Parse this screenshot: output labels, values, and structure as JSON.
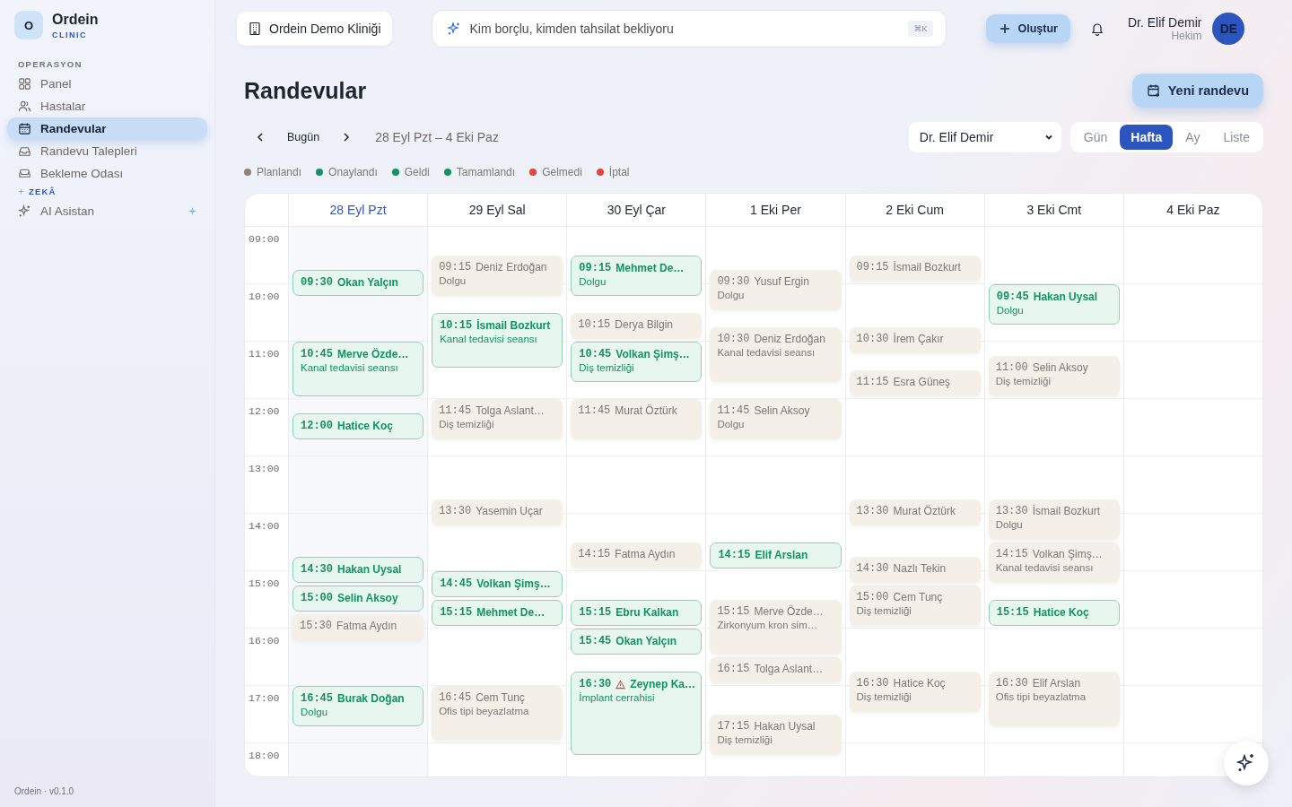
{
  "brand": {
    "logo_letter": "O",
    "name": "Ordein",
    "subtitle": "CLINIC"
  },
  "sidebar": {
    "sections": [
      {
        "title": "OPERASYON",
        "sparkle": false,
        "items": [
          {
            "label": "Panel",
            "selected": false,
            "sparkle": false
          },
          {
            "label": "Hastalar",
            "selected": false,
            "sparkle": false
          },
          {
            "label": "Randevular",
            "selected": true,
            "sparkle": false
          },
          {
            "label": "Randevu Talepleri",
            "selected": false,
            "sparkle": false
          },
          {
            "label": "Bekleme Odası",
            "selected": false,
            "sparkle": false
          }
        ]
      },
      {
        "title": "ZEKÂ",
        "sparkle": true,
        "items": [
          {
            "label": "AI Asistan",
            "selected": false,
            "sparkle": true
          }
        ]
      }
    ],
    "footer": "Ordein · v0.1.0"
  },
  "topbar": {
    "clinic": "Ordein Demo Kliniği",
    "search_value": "Kim borçlu, kimden tahsilat bekliyoru",
    "shortcut": "⌘K",
    "create_button": "Oluştur",
    "user_name": "Dr. Elif Demir",
    "user_role": "Hekim",
    "avatar": "DE"
  },
  "page": {
    "title": "Randevular",
    "new_button": "Yeni randevu",
    "today_button": "Bugün",
    "range": "28 Eyl Pzt – 4 Eki Paz",
    "doctor": "Dr. Elif Demir",
    "views": [
      {
        "label": "Gün",
        "selected": false
      },
      {
        "label": "Hafta",
        "selected": true
      },
      {
        "label": "Ay",
        "selected": false
      },
      {
        "label": "Liste",
        "selected": false
      }
    ]
  },
  "legend": [
    {
      "label": "Planlandı",
      "color": "#8a8378"
    },
    {
      "label": "Onaylandı",
      "color": "#14935f"
    },
    {
      "label": "Geldi",
      "color": "#14935f"
    },
    {
      "label": "Tamamlandı",
      "color": "#14935f"
    },
    {
      "label": "Gelmedi",
      "color": "#e5443a"
    },
    {
      "label": "İptal",
      "color": "#e5443a"
    }
  ],
  "calendar": {
    "hours": [
      "09:00",
      "10:00",
      "11:00",
      "12:00",
      "13:00",
      "14:00",
      "15:00",
      "16:00",
      "17:00",
      "18:00"
    ],
    "days": [
      {
        "label": "28 Eyl Pzt",
        "selected": true,
        "events": [
          {
            "time": "09:30",
            "name": "Okan Yalçın",
            "kind": "short",
            "confirmed": true,
            "warning": false
          },
          {
            "time": "10:45",
            "name": "Merve Özde…",
            "service": "Kanal tedavisi seansı",
            "kind": "long",
            "confirmed": true,
            "warning": false
          },
          {
            "time": "12:00",
            "name": "Hatice Koç",
            "kind": "short",
            "confirmed": true,
            "warning": false
          },
          {
            "time": "14:30",
            "name": "Hakan Uysal",
            "kind": "short",
            "confirmed": true,
            "warning": false
          },
          {
            "time": "15:00",
            "name": "Selin Aksoy",
            "kind": "short",
            "confirmed": true,
            "warning": false
          },
          {
            "time": "15:30",
            "name": "Fatma Aydın",
            "kind": "short",
            "confirmed": false,
            "warning": false
          },
          {
            "time": "16:45",
            "name": "Burak Doğan",
            "service": "Dolgu",
            "kind": "medium",
            "confirmed": true,
            "warning": false
          }
        ]
      },
      {
        "label": "29 Eyl Sal",
        "selected": false,
        "events": [
          {
            "time": "09:15",
            "name": "Deniz Erdoğan",
            "service": "Dolgu",
            "kind": "medium",
            "confirmed": false,
            "warning": false
          },
          {
            "time": "10:15",
            "name": "İsmail Bozkurt",
            "service": "Kanal tedavisi seansı",
            "kind": "long",
            "confirmed": true,
            "warning": false
          },
          {
            "time": "11:45",
            "name": "Tolga Aslant…",
            "service": "Diş temizliği",
            "kind": "medium",
            "confirmed": false,
            "warning": false
          },
          {
            "time": "13:30",
            "name": "Yasemin Uçar",
            "kind": "short",
            "confirmed": false,
            "warning": false
          },
          {
            "time": "14:45",
            "name": "Volkan Şimş…",
            "kind": "short",
            "confirmed": true,
            "warning": false
          },
          {
            "time": "15:15",
            "name": "Mehmet De…",
            "kind": "short",
            "confirmed": true,
            "warning": false
          },
          {
            "time": "16:45",
            "name": "Cem Tunç",
            "service": "Ofis tipi beyazlatma",
            "kind": "long",
            "confirmed": false,
            "warning": false
          }
        ]
      },
      {
        "label": "30 Eyl Çar",
        "selected": false,
        "events": [
          {
            "time": "09:15",
            "name": "Mehmet De…",
            "service": "Dolgu",
            "kind": "medium",
            "confirmed": true,
            "warning": false
          },
          {
            "time": "10:15",
            "name": "Derya Bilgin",
            "kind": "short",
            "confirmed": false,
            "warning": false
          },
          {
            "time": "10:45",
            "name": "Volkan Şimş…",
            "service": "Diş temizliği",
            "kind": "medium",
            "confirmed": true,
            "warning": false
          },
          {
            "time": "11:45",
            "name": "Murat Öztürk",
            "kind": "medium",
            "confirmed": false,
            "warning": false
          },
          {
            "time": "14:15",
            "name": "Fatma Aydın",
            "kind": "short",
            "confirmed": false,
            "warning": false
          },
          {
            "time": "15:15",
            "name": "Ebru Kalkan",
            "kind": "short",
            "confirmed": true,
            "warning": false
          },
          {
            "time": "15:45",
            "name": "Okan Yalçın",
            "kind": "short",
            "confirmed": true,
            "warning": false
          },
          {
            "time": "16:30",
            "name": "Zeynep Ka…",
            "service": "İmplant cerrahisi",
            "kind": "xlong",
            "confirmed": true,
            "warning": true
          }
        ]
      },
      {
        "label": "1 Eki Per",
        "selected": false,
        "events": [
          {
            "time": "09:30",
            "name": "Yusuf Ergin",
            "service": "Dolgu",
            "kind": "medium",
            "confirmed": false,
            "warning": false
          },
          {
            "time": "10:30",
            "name": "Deniz Erdoğan",
            "service": "Kanal tedavisi seansı",
            "kind": "long",
            "confirmed": false,
            "warning": false
          },
          {
            "time": "11:45",
            "name": "Selin Aksoy",
            "service": "Dolgu",
            "kind": "medium",
            "confirmed": false,
            "warning": false
          },
          {
            "time": "14:15",
            "name": "Elif Arslan",
            "kind": "short",
            "confirmed": true,
            "warning": false
          },
          {
            "time": "15:15",
            "name": "Merve Özde…",
            "service": "Zirkonyum kron sim…",
            "kind": "long",
            "confirmed": false,
            "warning": false
          },
          {
            "time": "16:15",
            "name": "Tolga Aslant…",
            "kind": "short",
            "confirmed": false,
            "warning": false
          },
          {
            "time": "17:15",
            "name": "Hakan Uysal",
            "service": "Diş temizliği",
            "kind": "medium",
            "confirmed": false,
            "warning": false
          }
        ]
      },
      {
        "label": "2 Eki Cum",
        "selected": false,
        "events": [
          {
            "time": "09:15",
            "name": "İsmail Bozkurt",
            "kind": "short",
            "confirmed": false,
            "warning": false
          },
          {
            "time": "10:30",
            "name": "İrem Çakır",
            "kind": "short",
            "confirmed": false,
            "warning": false
          },
          {
            "time": "11:15",
            "name": "Esra Güneş",
            "kind": "short",
            "confirmed": false,
            "warning": false
          },
          {
            "time": "13:30",
            "name": "Murat Öztürk",
            "kind": "short",
            "confirmed": false,
            "warning": false
          },
          {
            "time": "14:30",
            "name": "Nazlı Tekin",
            "kind": "short",
            "confirmed": false,
            "warning": false
          },
          {
            "time": "15:00",
            "name": "Cem Tunç",
            "service": "Diş temizliği",
            "kind": "medium",
            "confirmed": false,
            "warning": false
          },
          {
            "time": "16:30",
            "name": "Hatice Koç",
            "service": "Diş temizliği",
            "kind": "medium",
            "confirmed": false,
            "warning": false
          }
        ]
      },
      {
        "label": "3 Eki Cmt",
        "selected": false,
        "events": [
          {
            "time": "09:45",
            "name": "Hakan Uysal",
            "service": "Dolgu",
            "kind": "medium",
            "confirmed": true,
            "warning": false
          },
          {
            "time": "11:00",
            "name": "Selin Aksoy",
            "service": "Diş temizliği",
            "kind": "medium",
            "confirmed": false,
            "warning": false
          },
          {
            "time": "13:30",
            "name": "İsmail Bozkurt",
            "service": "Dolgu",
            "kind": "medium",
            "confirmed": false,
            "warning": false
          },
          {
            "time": "14:15",
            "name": "Volkan Şimş…",
            "service": "Kanal tedavisi seansı",
            "kind": "medium",
            "confirmed": false,
            "warning": false
          },
          {
            "time": "15:15",
            "name": "Hatice Koç",
            "kind": "short",
            "confirmed": true,
            "warning": false
          },
          {
            "time": "16:30",
            "name": "Elif Arslan",
            "service": "Ofis tipi beyazlatma",
            "kind": "long",
            "confirmed": false,
            "warning": false
          }
        ]
      },
      {
        "label": "4 Eki Paz",
        "selected": false
      }
    ]
  }
}
